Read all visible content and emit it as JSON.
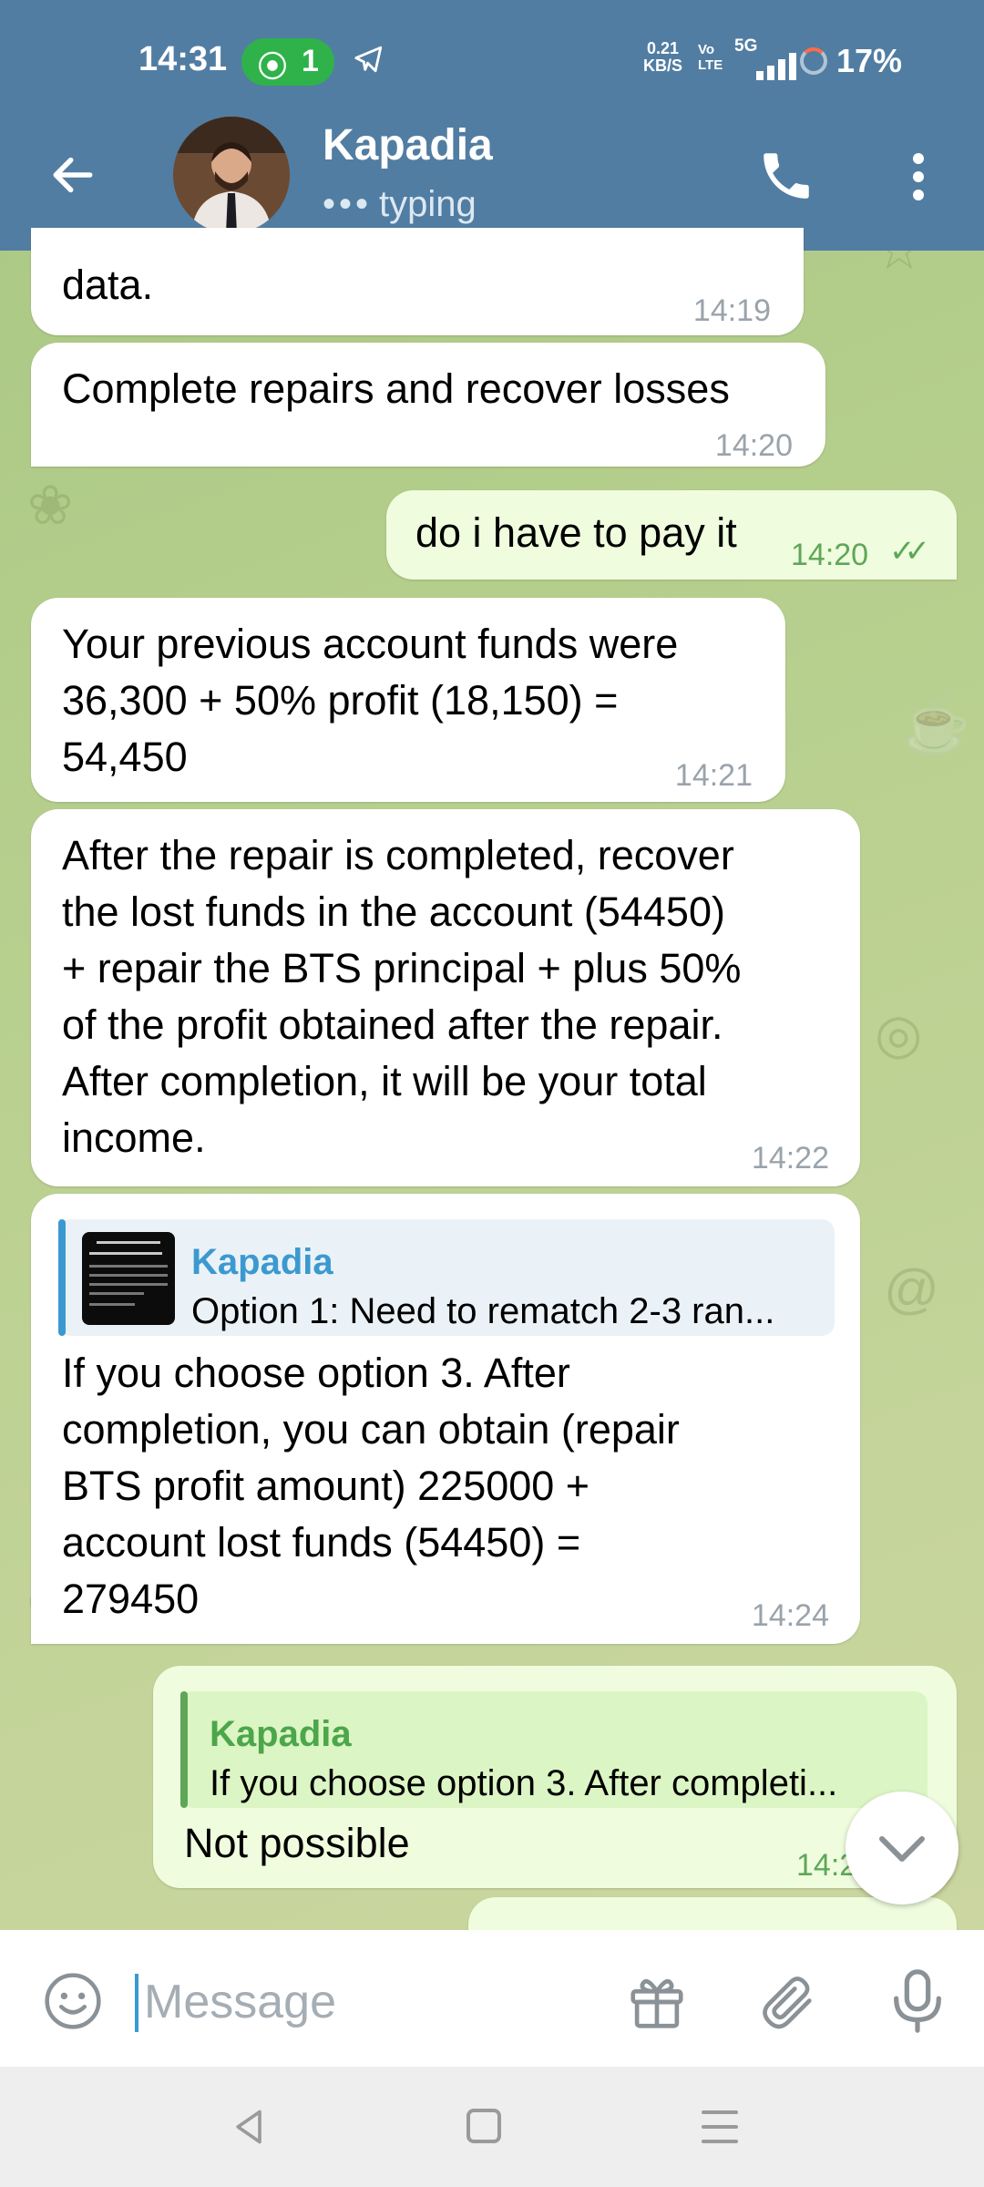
{
  "status_bar": {
    "time": "14:31",
    "hotspot_count": "1",
    "net_speed_value": "0.21",
    "net_speed_unit": "KB/S",
    "volte_top": "Vo",
    "volte_bottom": "LTE",
    "network": "5G",
    "battery": "17%"
  },
  "header": {
    "contact_name": "Kapadia",
    "status": "typing",
    "icons": [
      "back-arrow-icon",
      "avatar",
      "phone-icon",
      "more-vert-icon"
    ],
    "colors": {
      "header_bg": "#517da2",
      "hotspot_green": "#2fb24a"
    }
  },
  "messages": [
    {
      "direction": "in",
      "text": "data.",
      "time": "14:19"
    },
    {
      "direction": "in",
      "text": "Complete repairs and recover losses",
      "time": "14:20"
    },
    {
      "direction": "out",
      "text": "do i have to pay it",
      "time": "14:20",
      "read": true
    },
    {
      "direction": "in",
      "text": "Your previous account funds were\n36,300 + 50% profit (18,150) =\n54,450",
      "time": "14:21"
    },
    {
      "direction": "in",
      "text": "After the repair is completed, recover\nthe lost funds in the account (54450)\n+ repair the BTS principal + plus 50%\nof the profit obtained after the repair.\nAfter completion, it will be your total\nincome.",
      "time": "14:22"
    },
    {
      "direction": "in",
      "reply_to": {
        "name": "Kapadia",
        "text": "Option 1: Need to rematch 2-3 ran..."
      },
      "text": "If you choose option 3. After\ncompletion, you can obtain (repair\nBTS profit amount) 225000 +\naccount lost funds (54450) =\n279450",
      "time": "14:24"
    },
    {
      "direction": "out",
      "reply_to": {
        "name": "Kapadia",
        "text": "If you choose option 3. After completi..."
      },
      "text": "Not possible",
      "time": "14:2"
    }
  ],
  "composer": {
    "placeholder": "Message",
    "icons": [
      "emoji-icon",
      "gift-icon",
      "attach-icon",
      "mic-icon"
    ]
  },
  "nav_bar": {
    "icons": [
      "nav-back-icon",
      "nav-home-icon",
      "nav-recents-icon"
    ]
  },
  "colors": {
    "incoming_bubble": "#ffffff",
    "outgoing_bubble": "#effdde",
    "accent_blue": "#3c99d0",
    "outgoing_time": "#5ea758"
  }
}
